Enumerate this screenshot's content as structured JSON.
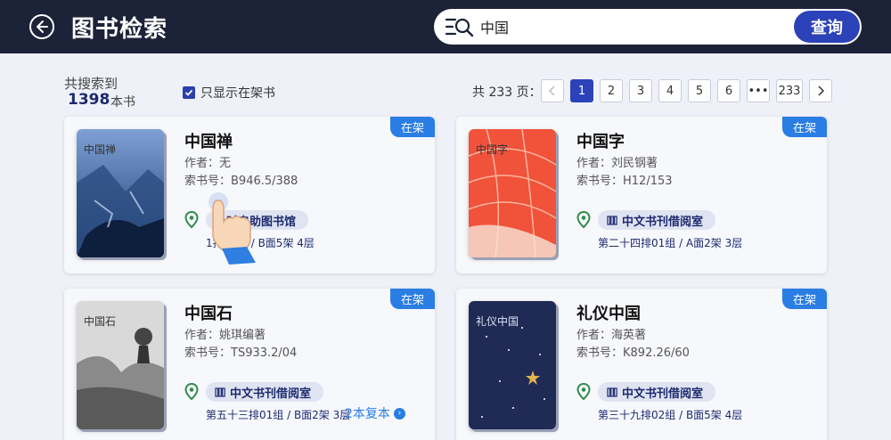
{
  "header": {
    "title": "图书检索",
    "back_icon": "back-arrow-icon"
  },
  "search": {
    "value": "中国",
    "button_label": "查询",
    "icon": "search-list-icon"
  },
  "results": {
    "label": "共搜索到",
    "count": "1398",
    "unit": "本书",
    "filter_label": "只显示在架书",
    "filter_checked": true
  },
  "pagination": {
    "info": "共 233 页：",
    "pages": [
      "1",
      "2",
      "3",
      "4",
      "5",
      "6",
      "•••",
      "233"
    ],
    "current": "1"
  },
  "books": [
    {
      "status": "在架",
      "cover_title": "中国禅",
      "title": "中国禅",
      "author": "作者：无",
      "call_number": "索书号：B946.5/388",
      "location": "小时自助图书馆",
      "shelf": "1排01组 / B面5架  4层"
    },
    {
      "status": "在架",
      "cover_title": "中国字",
      "title": "中国字",
      "author": "作者：刘民钢著",
      "call_number": "索书号：H12/153",
      "location": "中文书刊借阅室",
      "shelf": "第二十四排01组 / A面2架  3层"
    },
    {
      "status": "在架",
      "cover_title": "中国石",
      "title": "中国石",
      "author": "作者：姚琪编著",
      "call_number": "索书号：TS933.2/04",
      "location": "中文书刊借阅室",
      "shelf": "第五十三排01组 / B面2架  3层",
      "copies": "2本复本"
    },
    {
      "status": "在架",
      "cover_title": "礼仪中国",
      "title": "礼仪中国",
      "author": "作者：海英著",
      "call_number": "索书号：K892.26/60",
      "location": "中文书刊借阅室",
      "shelf": "第三十九排02组 / B面5架  4层"
    }
  ],
  "colors": {
    "header_bg": "#1c2238",
    "accent": "#2c42b8",
    "badge": "#2a7de3",
    "background": "#eef1f8"
  }
}
